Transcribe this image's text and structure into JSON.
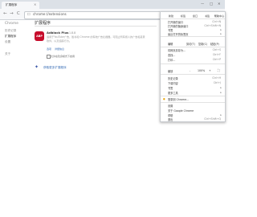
{
  "window": {
    "tab_title": "扩展程序",
    "tab_close": "×",
    "controls": [
      "—",
      "□",
      "✕"
    ]
  },
  "toolbar": {
    "back": "←",
    "forward": "→",
    "reload": "C",
    "url_icon": "☐",
    "url": "chrome://extensions",
    "star": "☆",
    "shield": "◎",
    "abp_badge": "ABP"
  },
  "sidebar": {
    "title": "Chrome",
    "items": [
      "历史记录",
      "扩展程序",
      "设置",
      "关于"
    ],
    "active": 1
  },
  "main": {
    "title": "扩展程序",
    "extension": {
      "icon_label": "ABP",
      "name": "Adblock Plus",
      "version": "1.8.8",
      "description_lines": [
        "适用于YouTube广告、脸书和 Chrome 的有效广告拦截器。可阻止所有烦人的广告和恶意",
        "软件，以及追踪行为。"
      ],
      "options_link": "选项",
      "details_link": "详细信息",
      "incognito_label": "允许在隐身模式下启用"
    },
    "more_link": "获取更多扩展程序"
  },
  "menu": {
    "top_row": [
      "新建",
      "标签",
      "窗口",
      "书签",
      "帮助中心"
    ],
    "items": [
      {
        "label": "打开新的窗口",
        "shortcut": "Ctrl+N"
      },
      {
        "label": "打开新的隐身窗口",
        "shortcut": "Ctrl+Shift+N"
      },
      {
        "label": "书签",
        "shortcut": ""
      },
      {
        "label": "最近打开的标签页",
        "shortcut": ""
      },
      {
        "label": "编辑",
        "cells": [
          "剪切(T)",
          "复制(C)",
          "粘贴(P)"
        ]
      },
      {
        "label": "将网页另存为...",
        "shortcut": "Ctrl+S"
      },
      {
        "label": "查找...",
        "shortcut": "Ctrl+F"
      },
      {
        "label": "打印...",
        "shortcut": "Ctrl+P"
      },
      {
        "label": "缩放",
        "cells": [
          "-",
          "100%",
          "+"
        ]
      },
      {
        "label": "历史记录",
        "shortcut": "Ctrl+H"
      },
      {
        "label": "下载内容",
        "shortcut": "Ctrl+J"
      },
      {
        "label": "书签",
        "shortcut": ""
      },
      {
        "label": "更多工具",
        "shortcut": ""
      },
      {
        "label": "登录到 Chrome...",
        "shortcut": ""
      },
      {
        "label": "设置",
        "shortcut": ""
      },
      {
        "label": "关于 Google Chrome",
        "shortcut": ""
      },
      {
        "label": "帮助",
        "shortcut": ""
      },
      {
        "label": "退出",
        "shortcut": "Ctrl+Shift+Q"
      }
    ],
    "zoom_fullscreen": "⛶",
    "submenu_arrow": "▸"
  }
}
